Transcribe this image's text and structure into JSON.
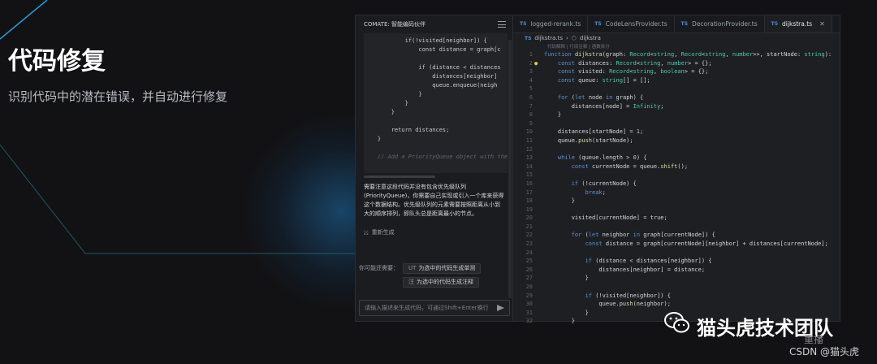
{
  "hero": {
    "title": "代码修复",
    "subtitle": "识别代码中的潜在错误，并自动进行修复"
  },
  "chat": {
    "header_title": "COMATE: 智能编码伙伴",
    "code_lines": [
      "            if(!visited[neighbor]) {",
      "                const distance = graph[c",
      "",
      "                if (distance < distances",
      "                    distances[neighbor]",
      "                    queue.enqueue(neigh",
      "                }",
      "            }",
      "        }",
      "",
      "        return distances;",
      "    }",
      "",
      "    // Add a PriorityQueue object with the c"
    ],
    "explanation": "需要注意这段代码并没有包含优先级队列(PriorityQueue)，你需要自己实现或引入一个库来获得这个数据结构。优先级队列的元素需要按照距离从小到大的顺序排列，即队头总是距离最小的节点。",
    "regenerate_label": "重新生成",
    "suggest_label": "你可能还需要：",
    "chips": [
      {
        "tag": "UT",
        "label": "为选中的代码生成单测"
      },
      {
        "tag": "注",
        "label": "为选中的代码生成注释"
      }
    ],
    "input_placeholder": "请输入描述来生成代码，可通过Shift+Enter换行"
  },
  "editor": {
    "tabs": [
      {
        "label": "logged-rerank.ts",
        "active": false
      },
      {
        "label": "CodeLensProvider.ts",
        "active": false
      },
      {
        "label": "DecorationProvider.ts",
        "active": false
      },
      {
        "label": "dijkstra.ts",
        "active": true
      }
    ],
    "breadcrumb": [
      "dijkstra.ts",
      "dijkstra"
    ],
    "codelens": "代码解释 | 行间注释 | 函数拆分",
    "lines": [
      {
        "n": "1",
        "t": "function dijkstra(graph: Record<string, Record<string, number>>, startNode: string):"
      },
      {
        "n": "2",
        "t": "    const distances: Record<string, number> = {};"
      },
      {
        "n": "3",
        "t": "    const visited: Record<string, boolean> = {};"
      },
      {
        "n": "4",
        "t": "    const queue: string[] = [];"
      },
      {
        "n": "5",
        "t": ""
      },
      {
        "n": "6",
        "t": "    for (let node in graph) {"
      },
      {
        "n": "7",
        "t": "        distances[node] = Infinity;"
      },
      {
        "n": "8",
        "t": "    }"
      },
      {
        "n": "9",
        "t": ""
      },
      {
        "n": "10",
        "t": "    distances[startNode] = 1;"
      },
      {
        "n": "11",
        "t": "    queue.push(startNode);"
      },
      {
        "n": "12",
        "t": ""
      },
      {
        "n": "13",
        "t": "    while (queue.length > 0) {"
      },
      {
        "n": "14",
        "t": "        const currentNode = queue.shift();"
      },
      {
        "n": "15",
        "t": ""
      },
      {
        "n": "16",
        "t": "        if (!currentNode) {"
      },
      {
        "n": "17",
        "t": "            break;"
      },
      {
        "n": "18",
        "t": "        }"
      },
      {
        "n": "19",
        "t": ""
      },
      {
        "n": "20",
        "t": "        visited[currentNode] = true;"
      },
      {
        "n": "21",
        "t": ""
      },
      {
        "n": "22",
        "t": "        for (let neighbor in graph[currentNode]) {"
      },
      {
        "n": "23",
        "t": "            const distance = graph[currentNode][neighbor] + distances[currentNode];"
      },
      {
        "n": "24",
        "t": ""
      },
      {
        "n": "25",
        "t": "            if (distance < distances[neighbor]) {"
      },
      {
        "n": "26",
        "t": "                distances[neighbor] = distance;"
      },
      {
        "n": "27",
        "t": "            }"
      },
      {
        "n": "28",
        "t": ""
      },
      {
        "n": "29",
        "t": "            if (!visited[neighbor]) {"
      },
      {
        "n": "30",
        "t": "                queue.push(neighbor);"
      },
      {
        "n": "31",
        "t": "            }"
      },
      {
        "n": "32",
        "t": "        }"
      }
    ]
  },
  "watermark": {
    "brand": "猫头虎技术团队",
    "replay": "重播",
    "csdn": "CSDN @猫头虎"
  },
  "colors": {
    "background": "#121214",
    "accent_line": "#2b9bd6",
    "keyword": "#5f8fd9"
  }
}
